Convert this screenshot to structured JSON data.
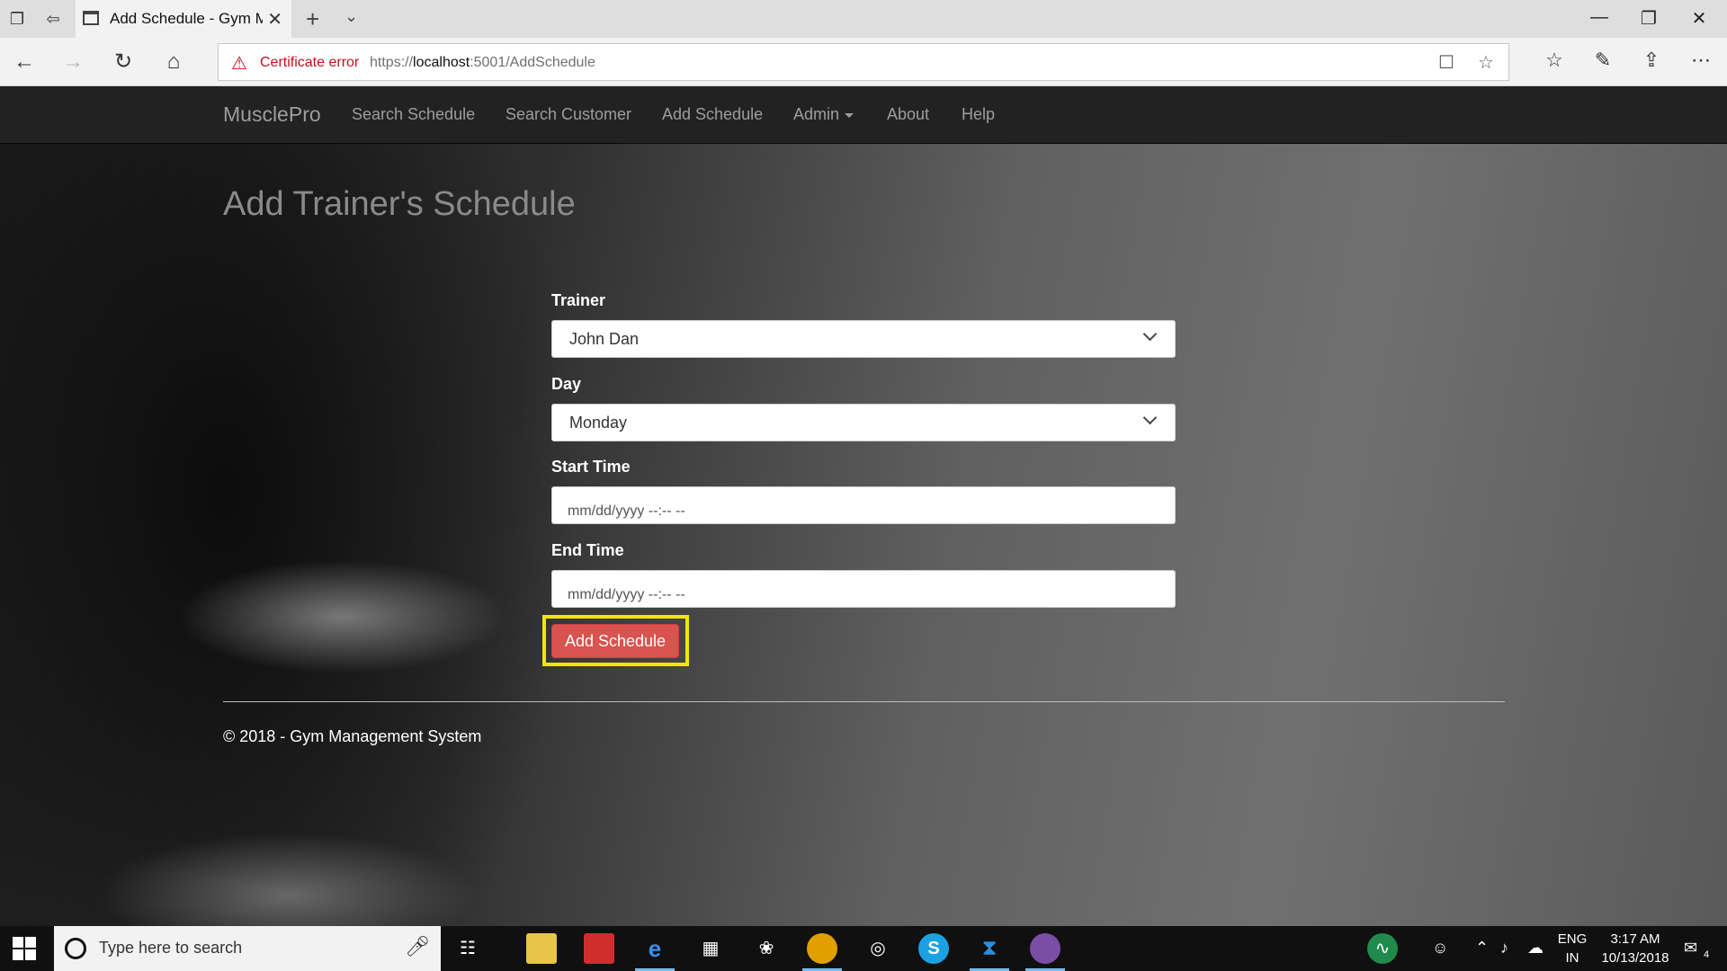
{
  "browser": {
    "tab_title": "Add Schedule - Gym Ma",
    "cert_error": "Certificate error",
    "url_prefix": "https://",
    "url_host": "localhost",
    "url_rest": ":5001/AddSchedule"
  },
  "navbar": {
    "brand": "MusclePro",
    "links": [
      "Search Schedule",
      "Search Customer",
      "Add Schedule",
      "Admin",
      "About",
      "Help"
    ]
  },
  "page": {
    "heading": "Add Trainer's Schedule",
    "trainer_label": "Trainer",
    "trainer_value": "John Dan",
    "day_label": "Day",
    "day_value": "Monday",
    "start_label": "Start Time",
    "start_placeholder": "mm/dd/yyyy --:-- --",
    "end_label": "End Time",
    "end_placeholder": "mm/dd/yyyy --:-- --",
    "submit_label": "Add Schedule",
    "footer": "© 2018 - Gym Management System"
  },
  "taskbar": {
    "search_placeholder": "Type here to search",
    "lang": "ENG",
    "region": "IN",
    "time": "3:17 AM",
    "date": "10/13/2018",
    "notifications": "4"
  },
  "colors": {
    "navbar_bg": "#222222",
    "danger_button": "#d9534f",
    "highlight": "#f2e600",
    "cert_error": "#c50f1f"
  }
}
